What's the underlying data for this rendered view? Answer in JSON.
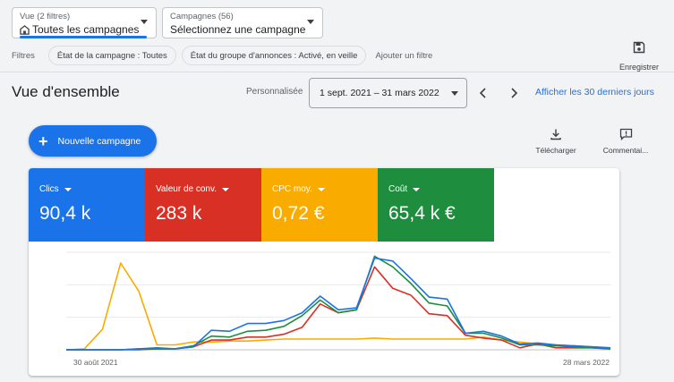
{
  "view_selector": {
    "label": "Vue (2 filtres)",
    "value": "Toutes les campagnes"
  },
  "campaign_selector": {
    "label": "Campagnes (56)",
    "value": "Sélectionnez une campagne"
  },
  "filters": {
    "label": "Filtres",
    "chips": [
      "État de la campagne : Toutes",
      "État du groupe d'annonces : Activé, en veille"
    ],
    "add_filter": "Ajouter un filtre"
  },
  "save_label": "Enregistrer",
  "overview": {
    "title": "Vue d'ensemble",
    "custom_label": "Personnalisée",
    "date_range": "1 sept. 2021 – 31 mars 2022",
    "last30_link": "Afficher les 30 derniers jours"
  },
  "new_campaign_label": "Nouvelle campagne",
  "tools": {
    "download": "Télécharger",
    "comment": "Commentai..."
  },
  "metrics": [
    {
      "label": "Clics",
      "value": "90,4 k",
      "color": "#1a73e8"
    },
    {
      "label": "Valeur de conv.",
      "value": "283 k",
      "color": "#d93025"
    },
    {
      "label": "CPC moy.",
      "value": "0,72 €",
      "color": "#f9ab00"
    },
    {
      "label": "Coût",
      "value": "65,4 k €",
      "color": "#1e8e3e"
    }
  ],
  "chart_data": {
    "type": "line",
    "x_start_label": "30 août 2021",
    "x_end_label": "28 mars 2022",
    "ylim": [
      0,
      100
    ],
    "grid": true,
    "series": [
      {
        "name": "Clics",
        "color": "#1a73e8",
        "values": [
          0,
          0,
          0,
          0,
          1,
          2,
          1,
          3,
          20,
          19,
          27,
          27,
          30,
          38,
          55,
          41,
          43,
          94,
          91,
          73,
          54,
          52,
          17,
          19,
          14,
          6,
          7,
          5,
          4,
          3,
          2
        ]
      },
      {
        "name": "Valeur de conv.",
        "color": "#d93025",
        "values": [
          0,
          0,
          0,
          0,
          0,
          1,
          1,
          3,
          10,
          10,
          13,
          13,
          16,
          23,
          47,
          38,
          41,
          85,
          63,
          56,
          37,
          35,
          15,
          12,
          10,
          2,
          6,
          2,
          2,
          2,
          1
        ]
      },
      {
        "name": "CPC moy.",
        "color": "#f9ab00",
        "values": [
          0,
          1,
          21,
          89,
          60,
          5,
          5,
          8,
          8,
          9,
          9,
          10,
          11,
          11,
          11,
          11,
          11,
          12,
          11,
          11,
          11,
          11,
          11,
          13,
          10,
          8,
          6,
          5,
          4,
          3,
          2
        ]
      },
      {
        "name": "Coût",
        "color": "#1e8e3e",
        "values": [
          0,
          0,
          0,
          0,
          1,
          1,
          1,
          4,
          14,
          13,
          19,
          20,
          24,
          35,
          51,
          38,
          41,
          96,
          85,
          68,
          48,
          45,
          17,
          17,
          12,
          5,
          5,
          4,
          3,
          2,
          1
        ]
      }
    ]
  }
}
